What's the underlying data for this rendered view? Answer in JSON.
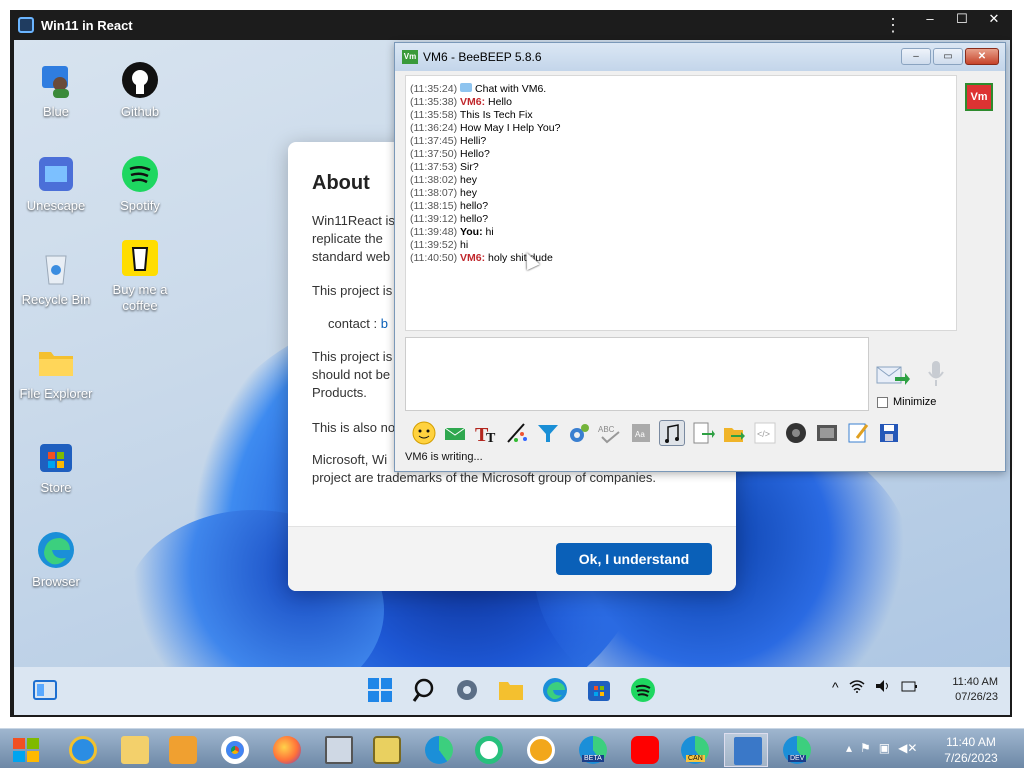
{
  "app": {
    "title": "Win11 in React",
    "menu_glyph": "⋮",
    "controls": [
      "–",
      "☐",
      "✕"
    ]
  },
  "desktop_icons": [
    {
      "name": "blue",
      "label": "Blue"
    },
    {
      "name": "github",
      "label": "Github"
    },
    {
      "name": "unescape",
      "label": "Unescape"
    },
    {
      "name": "spotify",
      "label": "Spotify"
    },
    {
      "name": "recycle-bin",
      "label": "Recycle Bin"
    },
    {
      "name": "buy-me-a-coffee",
      "label": "Buy me a coffee"
    },
    {
      "name": "file-explorer",
      "label": "File Explorer"
    },
    {
      "name": "store",
      "label": "Store"
    },
    {
      "name": "browser",
      "label": "Browser"
    }
  ],
  "about": {
    "title": "About",
    "p1": "Win11React is",
    "p1b": "replicate the",
    "p1c": "standard web",
    "p2": "This project is",
    "contact_label": "contact :",
    "contact_value": "b",
    "p3": "This project is",
    "p3b": "should not be",
    "p3c": "Products.",
    "p4": "This is also no",
    "p5": "Microsoft, Wi",
    "p5b": "project are trademarks of the Microsoft group of companies.",
    "ok_button": "Ok, I understand"
  },
  "win11_taskbar": {
    "icons": [
      "widgets-icon",
      "start-icon",
      "search-icon",
      "settings-icon",
      "file-explorer-icon",
      "edge-icon",
      "store-icon",
      "spotify-icon"
    ],
    "tray": [
      "^",
      "wifi",
      "volume",
      "battery"
    ],
    "time": "11:40 AM",
    "date": "07/26/23"
  },
  "beebeep": {
    "title": "VM6 - BeeBEEP 5.8.6",
    "messages": [
      {
        "time": "(11:35:24)",
        "who": "",
        "text": "Chat with VM6."
      },
      {
        "time": "(11:35:38)",
        "who": "VM6:",
        "text": "Hello"
      },
      {
        "time": "(11:35:58)",
        "who": "",
        "text": "This Is Tech Fix"
      },
      {
        "time": "(11:36:24)",
        "who": "",
        "text": "How May I Help You?"
      },
      {
        "time": "(11:37:45)",
        "who": "",
        "text": "Helli?"
      },
      {
        "time": "(11:37:50)",
        "who": "",
        "text": "Hello?"
      },
      {
        "time": "(11:37:53)",
        "who": "",
        "text": "Sir?"
      },
      {
        "time": "(11:38:02)",
        "who": "",
        "text": "hey"
      },
      {
        "time": "(11:38:07)",
        "who": "",
        "text": "hey"
      },
      {
        "time": "(11:38:15)",
        "who": "",
        "text": "hello?"
      },
      {
        "time": "(11:39:12)",
        "who": "",
        "text": "hello?"
      },
      {
        "time": "(11:39:48)",
        "who": "You:",
        "text": "hi"
      },
      {
        "time": "(11:39:52)",
        "who": "",
        "text": "hi"
      },
      {
        "time": "(11:40:50)",
        "who": "VM6:",
        "text": "holy shit dude"
      }
    ],
    "avatar_label": "Vm",
    "minimize_label": "Minimize",
    "status": "VM6 is writing..."
  },
  "win7_taskbar": {
    "time": "11:40 AM",
    "date": "7/26/2023",
    "badges": {
      "beta": "BETA",
      "can": "CAN",
      "dev": "DEV"
    }
  }
}
